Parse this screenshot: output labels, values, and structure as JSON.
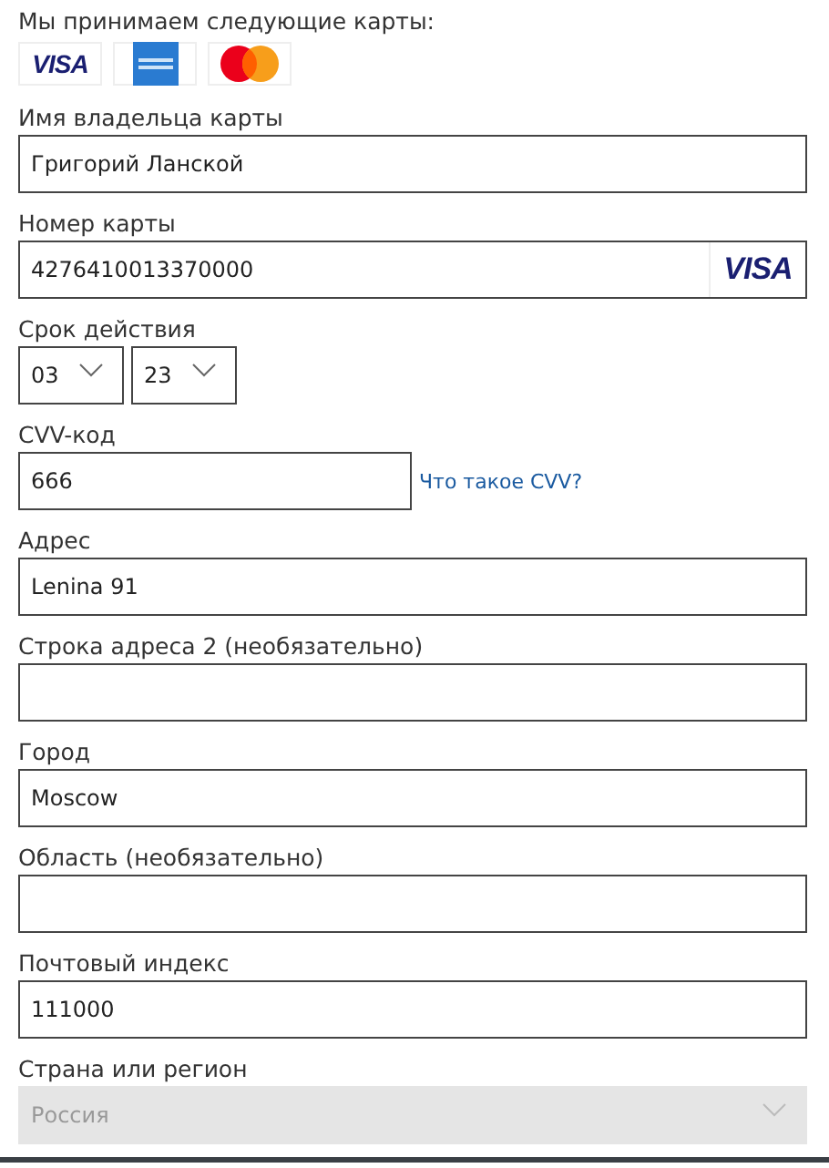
{
  "accepted_cards": {
    "label": "Мы принимаем следующие карты:",
    "cards": [
      {
        "kind": "visa",
        "text": "VISA"
      },
      {
        "kind": "amex"
      },
      {
        "kind": "mastercard"
      }
    ]
  },
  "fields": [
    {
      "kind": "text",
      "label": "Имя владельца карты",
      "value": "Григорий Ланской"
    },
    {
      "kind": "card",
      "label": "Номер карты",
      "value": "4276410013370000",
      "brand": "VISA"
    },
    {
      "kind": "expiry",
      "label": "Срок действия",
      "month": "03",
      "year": "23"
    },
    {
      "kind": "cvv",
      "label": "CVV-код",
      "value": "666",
      "link": "Что такое CVV?"
    },
    {
      "kind": "text",
      "label": "Адрес",
      "value": "Lenina 91"
    },
    {
      "kind": "text",
      "label": "Строка адреса 2 (необязательно)"
    },
    {
      "kind": "text",
      "label": "Город",
      "value": "Moscow"
    },
    {
      "kind": "text",
      "label": "Область (необязательно)"
    },
    {
      "kind": "text",
      "label": "Почтовый индекс",
      "value": "111000"
    },
    {
      "kind": "select",
      "label": "Страна или регион",
      "value": "Россия",
      "disabled": true
    }
  ]
}
